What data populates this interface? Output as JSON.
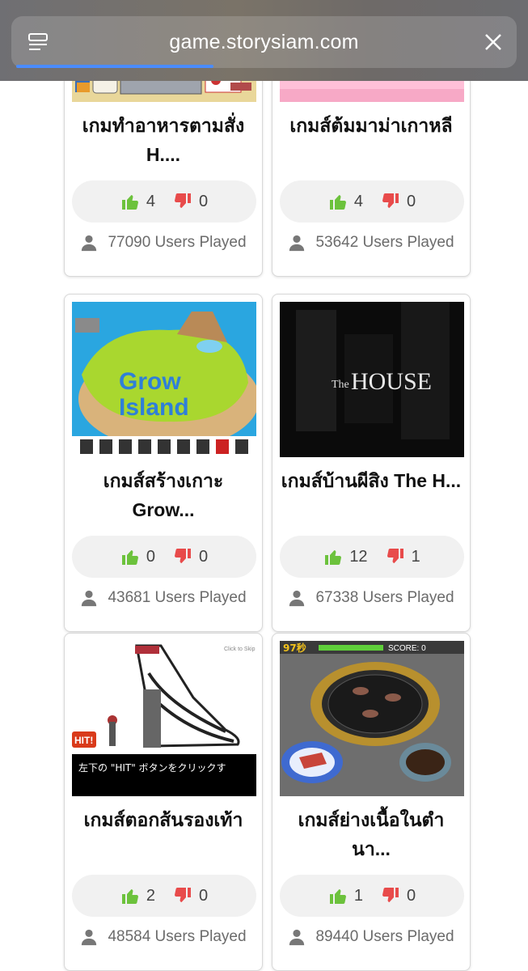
{
  "browser": {
    "url": "game.storysiam.com",
    "tabs_icon": "tab-overview-icon",
    "close_icon": "close-icon",
    "load_progress": 0.38
  },
  "colors": {
    "like": "#6cc23c",
    "dislike": "#e84b4b",
    "played_icon": "#777777"
  },
  "games": [
    {
      "title": "เกมทำอาหารตามสั่ง H....",
      "likes": "4",
      "dislikes": "0",
      "played": "77090 Users Played"
    },
    {
      "title": "เกมส์ต้มมาม่าเกาหลี",
      "likes": "4",
      "dislikes": "0",
      "played": "53642 Users Played"
    },
    {
      "title": "เกมส์สร้างเกาะ Grow...",
      "likes": "0",
      "dislikes": "0",
      "played": "43681 Users Played",
      "thumb_text": [
        "Grow",
        "Island"
      ]
    },
    {
      "title": "เกมส์บ้านผีสิง The H...",
      "likes": "12",
      "dislikes": "1",
      "played": "67338 Users Played",
      "thumb_text": [
        "The",
        "HOUSE"
      ]
    },
    {
      "title": "เกมส์ตอกส้นรองเท้า",
      "likes": "2",
      "dislikes": "0",
      "played": "48584 Users Played",
      "thumb_text": [
        "Click to Skip",
        "HIT!",
        "左下の \"HIT\" ボタンをクリックす"
      ]
    },
    {
      "title": "เกมส์ย่างเนื้อในตำ นา...",
      "likes": "1",
      "dislikes": "0",
      "played": "89440 Users Played",
      "thumb_text": [
        "97秒",
        "SCORE: 0"
      ]
    }
  ]
}
